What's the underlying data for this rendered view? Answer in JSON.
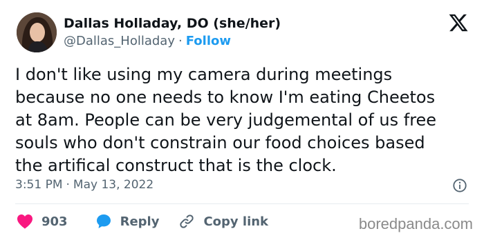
{
  "author": {
    "name": "Dallas Holladay, DO (she/her)",
    "handle": "@Dallas_Holladay",
    "separator": "·",
    "follow_label": "Follow"
  },
  "tweet": {
    "text": "I don't like using my camera during meetings\nbecause no one needs to know I'm eating Cheetos\nat 8am. People can be very judgemental of us free\nsouls who don't constrain our food choices based\nthe artifical construct that is the clock.",
    "time": "3:51 PM",
    "separator": "·",
    "date": "May 13, 2022"
  },
  "actions": {
    "like_count": "903",
    "reply_label": "Reply",
    "copy_link_label": "Copy link"
  },
  "watermark": "boredpanda.com",
  "colors": {
    "accent": "#1d9bf0",
    "like": "#f91880",
    "text": "#0f1419",
    "muted": "#536471"
  },
  "icons": [
    "avatar",
    "x-logo-icon",
    "info-icon",
    "heart-icon",
    "reply-bubble-icon",
    "link-icon"
  ]
}
